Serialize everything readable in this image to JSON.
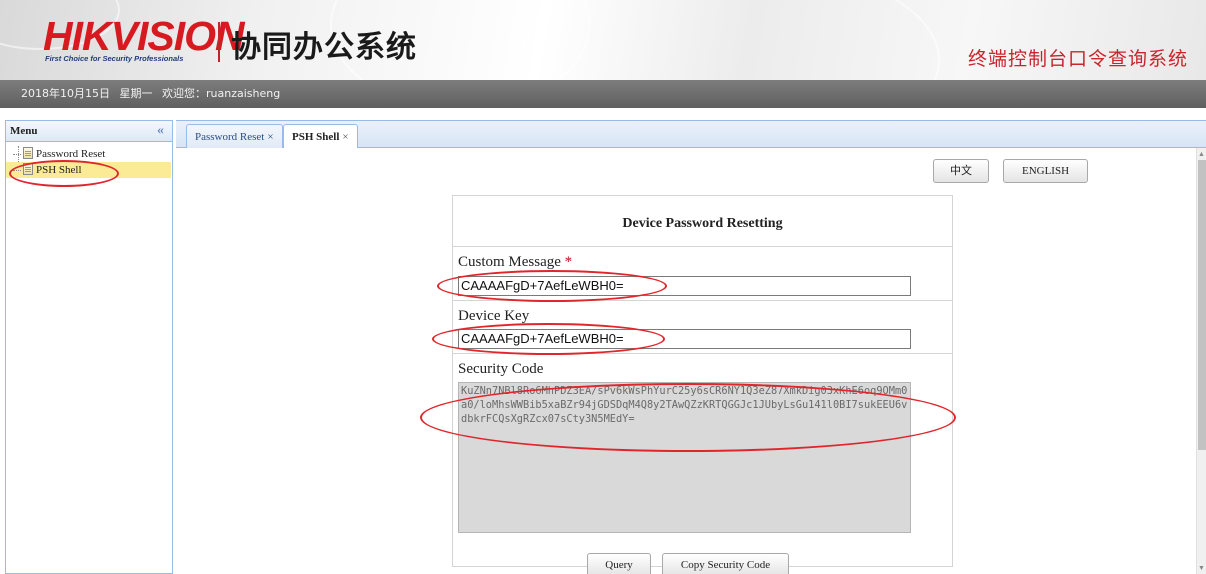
{
  "header": {
    "logo_text": "HIKVISION",
    "logo_tagline": "First Choice for Security Professionals",
    "system_title": "协同办公系统",
    "right_title": "终端控制台口令查询系统"
  },
  "infobar": {
    "date": "2018年10月15日",
    "weekday": "星期一",
    "welcome": "欢迎您：ruanzaisheng"
  },
  "menu": {
    "title": "Menu",
    "collapse_icon": "«",
    "items": [
      {
        "label": "Password Reset"
      },
      {
        "label": "PSH Shell",
        "selected": true
      }
    ]
  },
  "tabs": [
    {
      "label": "Password Reset",
      "close": "×"
    },
    {
      "label": "PSH Shell",
      "close": "×",
      "active": true
    }
  ],
  "language": {
    "chinese": "中文",
    "english": "ENGLISH"
  },
  "form": {
    "title": "Device Password Resetting",
    "custom_message_label": "Custom Message",
    "required_mark": "*",
    "custom_message_value": "CAAAAFgD+7AefLeWBH0=",
    "device_key_label": "Device Key",
    "device_key_value": "CAAAAFgD+7AefLeWBH0=",
    "security_code_label": "Security Code",
    "security_code_value": "KuZNn7NBl8Ro6MhPDZ3EA/sPv6kWsPhYurC25y6sCR6NY1Q3eZ87XmkDig03xKhE6oq9OMm0a0/loMhsWWBib5xaBZr94jGDSDqM4Q8y2TAwQZzKRTQGGJc1JUbyLsGu141l0BI7sukEEU6vdbkrFCQsXgRZcx07sCty3N5MEdY="
  },
  "buttons": {
    "query": "Query",
    "copy": "Copy Security Code"
  },
  "annotation_color": "#e0262b"
}
